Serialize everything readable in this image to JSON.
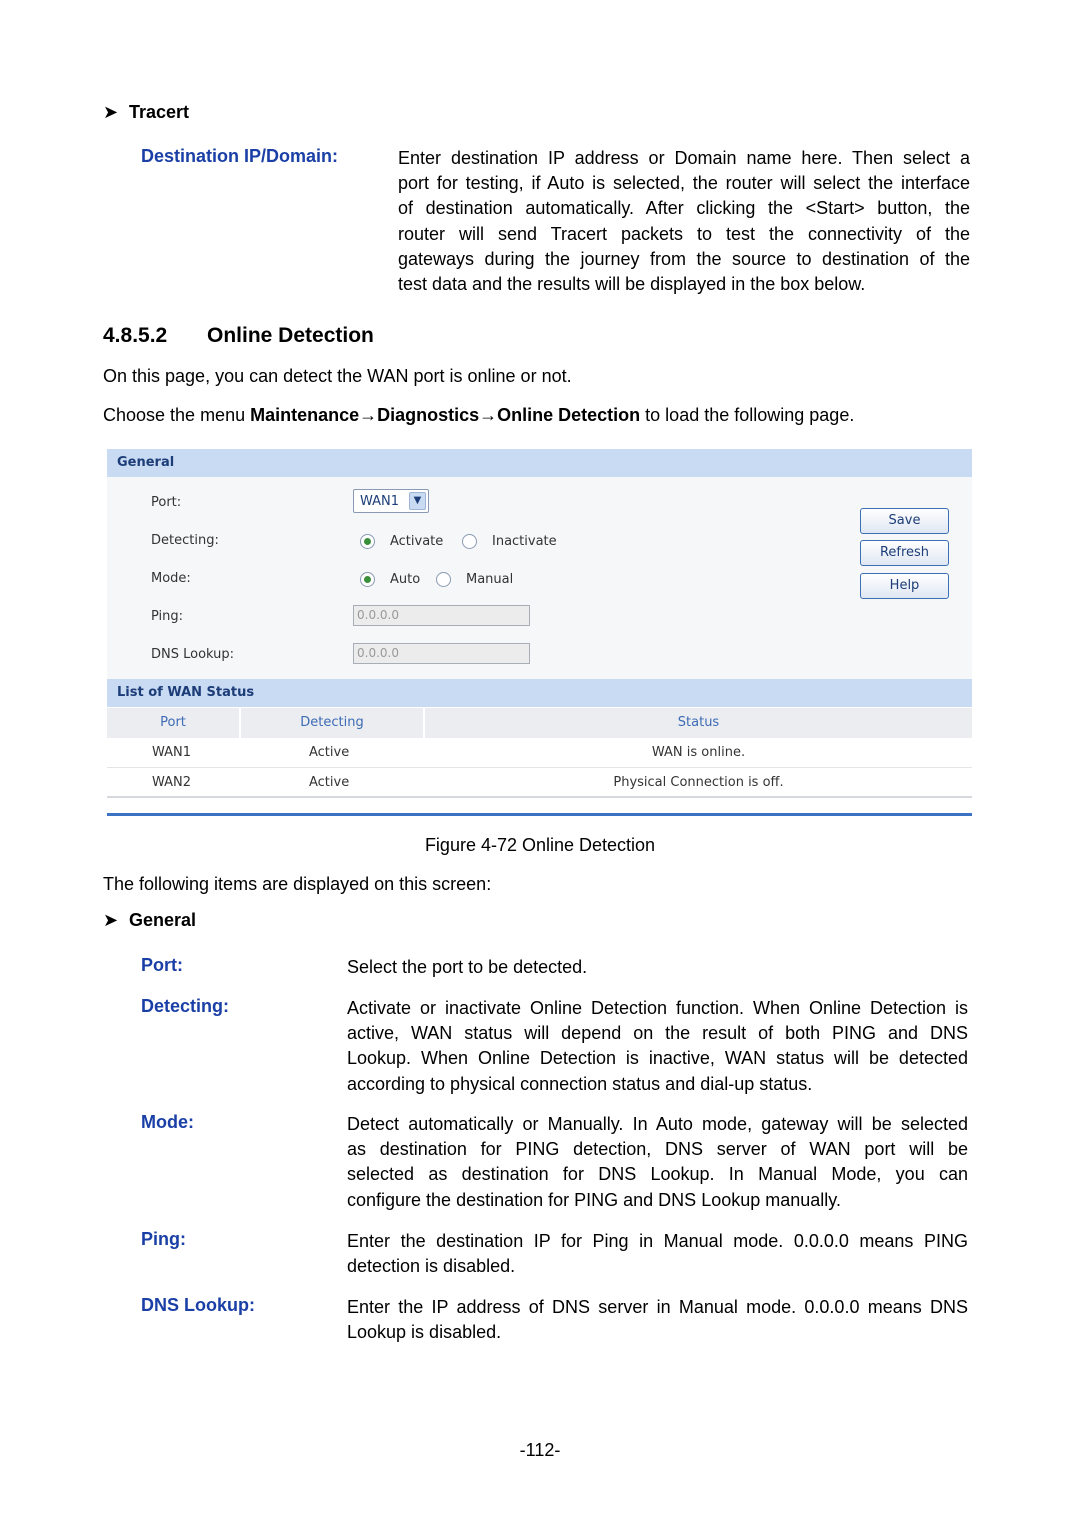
{
  "tracert": {
    "heading": "Tracert",
    "items": [
      {
        "term": "Destination IP/Domain:",
        "lines": [
          "Enter destination IP address or Domain name here. Then select a",
          "port for testing, if Auto is selected, the router will select the interface",
          "of destination automatically. After clicking the <Start> button, the",
          "router will send Tracert packets to test the connectivity of the",
          "gateways during the journey from the source to destination of the",
          "test data and the results will be displayed in the box below."
        ]
      }
    ]
  },
  "section": {
    "number": "4.8.5.2",
    "title": "Online Detection",
    "intro": "On this page, you can detect the WAN port is online or not.",
    "menu_prefix": "Choose the menu ",
    "menu_path": "Maintenance→Diagnostics→Online Detection",
    "menu_suffix": " to load the following page."
  },
  "figure": {
    "general_header": "General",
    "fields": {
      "port_label": "Port:",
      "port_value": "WAN1",
      "detecting_label": "Detecting:",
      "detecting_options": [
        "Activate",
        "Inactivate"
      ],
      "detecting_selected": "Activate",
      "mode_label": "Mode:",
      "mode_options": [
        "Auto",
        "Manual"
      ],
      "mode_selected": "Auto",
      "ping_label": "Ping:",
      "ping_value": "0.0.0.0",
      "dns_label": "DNS Lookup:",
      "dns_value": "0.0.0.0"
    },
    "buttons": {
      "save": "Save",
      "refresh": "Refresh",
      "help": "Help"
    },
    "list_header": "List of WAN Status",
    "table": {
      "columns": [
        "Port",
        "Detecting",
        "Status"
      ],
      "rows": [
        [
          "WAN1",
          "Active",
          "WAN is online."
        ],
        [
          "WAN2",
          "Active",
          "Physical Connection is off."
        ]
      ]
    },
    "caption": "Figure 4-72 Online Detection"
  },
  "following": "The following items are displayed on this screen:",
  "general": {
    "heading": "General",
    "items": [
      {
        "term": "Port:",
        "lines": [
          "Select the port to be detected."
        ]
      },
      {
        "term": "Detecting:",
        "lines": [
          "Activate or inactivate Online Detection function. When Online Detection is",
          "active, WAN status will depend on the result of both PING and DNS",
          "Lookup. When Online Detection is inactive, WAN status will be detected",
          "according to physical connection status and dial-up status."
        ]
      },
      {
        "term": "Mode:",
        "lines": [
          "Detect automatically or Manually. In Auto mode, gateway will be selected",
          "as destination for PING detection, DNS server of WAN port will be",
          "selected as destination for DNS Lookup. In Manual Mode, you can",
          "configure the destination for PING and DNS Lookup manually."
        ]
      },
      {
        "term": "Ping:",
        "lines": [
          "Enter the destination IP for Ping in Manual mode. 0.0.0.0 means PING",
          "detection is disabled."
        ]
      },
      {
        "term": "DNS Lookup:",
        "lines": [
          "Enter the IP address of DNS server in Manual mode. 0.0.0.0 means DNS",
          "Lookup is disabled."
        ]
      }
    ]
  },
  "page_number": "-112-"
}
